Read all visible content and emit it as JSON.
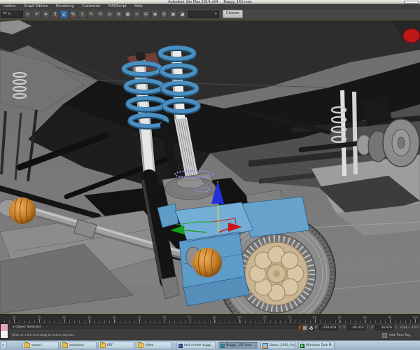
{
  "title_bar": {
    "app_title": "Autodesk 3ds Max 2014 x64",
    "document_name": "Buggy_142.max"
  },
  "menu_bar": {
    "items": [
      "mation",
      "Graph Editors",
      "Rendering",
      "Customize",
      "MAXScript",
      "Help"
    ]
  },
  "toolbar": {
    "selection_filter_value": "All",
    "cleaner_button_label": "Cleaner",
    "icons": [
      {
        "name": "select-and-link-icon",
        "glyph": "∞",
        "fg": "#c8c8c8"
      },
      {
        "name": "select-and-move-icon",
        "glyph": "+",
        "fg": "#dadada"
      },
      {
        "name": "select-object-icon",
        "glyph": "➤",
        "fg": "#cfcfcf"
      },
      {
        "name": "snap-toggle-icon",
        "glyph": "3",
        "fg": "#e0e0e0",
        "accent": "#d04010"
      },
      {
        "name": "angle-snap-icon",
        "glyph": "∠",
        "fg": "#ffffff",
        "active": true
      },
      {
        "name": "percent-snap-icon",
        "glyph": "%",
        "fg": "#d8d8d8",
        "accent": "#d04010"
      },
      {
        "name": "spinner-snap-icon",
        "glyph": "↕",
        "fg": "#cfcfcf",
        "accent": "#d04010"
      },
      {
        "name": "keyboard-override-icon",
        "glyph": "✎",
        "fg": "#e8d060"
      },
      {
        "name": "mirror-icon",
        "glyph": "M",
        "fg": "#9ab8d8"
      },
      {
        "name": "align-icon",
        "glyph": "≡",
        "fg": "#c8c8c8"
      },
      {
        "name": "layer-manager-icon",
        "glyph": "≣",
        "fg": "#c0c0c0"
      },
      {
        "name": "graphite-ribbon-icon",
        "glyph": "▦",
        "fg": "#b8c8b0"
      },
      {
        "name": "curve-editor-icon",
        "glyph": "∿",
        "fg": "#c8d0b8"
      },
      {
        "name": "schematic-view-icon",
        "glyph": "⊞",
        "fg": "#c0c8d0"
      },
      {
        "name": "material-editor-icon",
        "glyph": "◉",
        "fg": "#d0b8c8"
      },
      {
        "name": "render-setup-icon",
        "glyph": "⚙",
        "fg": "#c8c8c8"
      },
      {
        "name": "rendered-frame-icon",
        "glyph": "▣",
        "fg": "#b8b8b8"
      },
      {
        "name": "render-production-icon",
        "glyph": "◕",
        "fg": "#dadada"
      }
    ]
  },
  "viewport": {
    "selected_object_color": "#6ea9d4",
    "gizmo_colors": {
      "x_axis": "#cc2020",
      "y_axis": "#1fa01f",
      "z_axis": "#2230dd",
      "axis_line": "#d6d63a"
    }
  },
  "track_bar": {
    "frame_labels": [
      "20",
      "25",
      "30",
      "35",
      "40",
      "45",
      "50",
      "55",
      "60",
      "65",
      "70",
      "75",
      "80",
      "85",
      "90",
      "95",
      "100"
    ]
  },
  "status_bar": {
    "selection_status": "1 Object Selected",
    "prompt": "Click or click-and-drag to select objects",
    "transform": {
      "x_label": "X:",
      "x_value": "-108.919",
      "y_label": "Y:",
      "y_value": "-90.053",
      "z_label": "Z:",
      "z_value": "36.976"
    },
    "grid_readout": "Grid = 10.0",
    "add_time_tag_label": "Add Time Tag"
  },
  "taskbar": {
    "items": [
      {
        "label": "y",
        "icon": "clipped"
      },
      {
        "label": "export",
        "icon": "folder"
      },
      {
        "label": "autoback",
        "icon": "folder"
      },
      {
        "label": "REF",
        "icon": "folder"
      },
      {
        "label": "video",
        "icon": "folder"
      },
      {
        "label": "test render bugg...",
        "icon": "photoshop"
      },
      {
        "label": "Buggy_142.max -...",
        "icon": "3dsmax",
        "active": true
      },
      {
        "label": "Dakar_2006_Hum...",
        "icon": "image"
      },
      {
        "label": "Windows Task M...",
        "icon": "taskmanager"
      }
    ]
  }
}
